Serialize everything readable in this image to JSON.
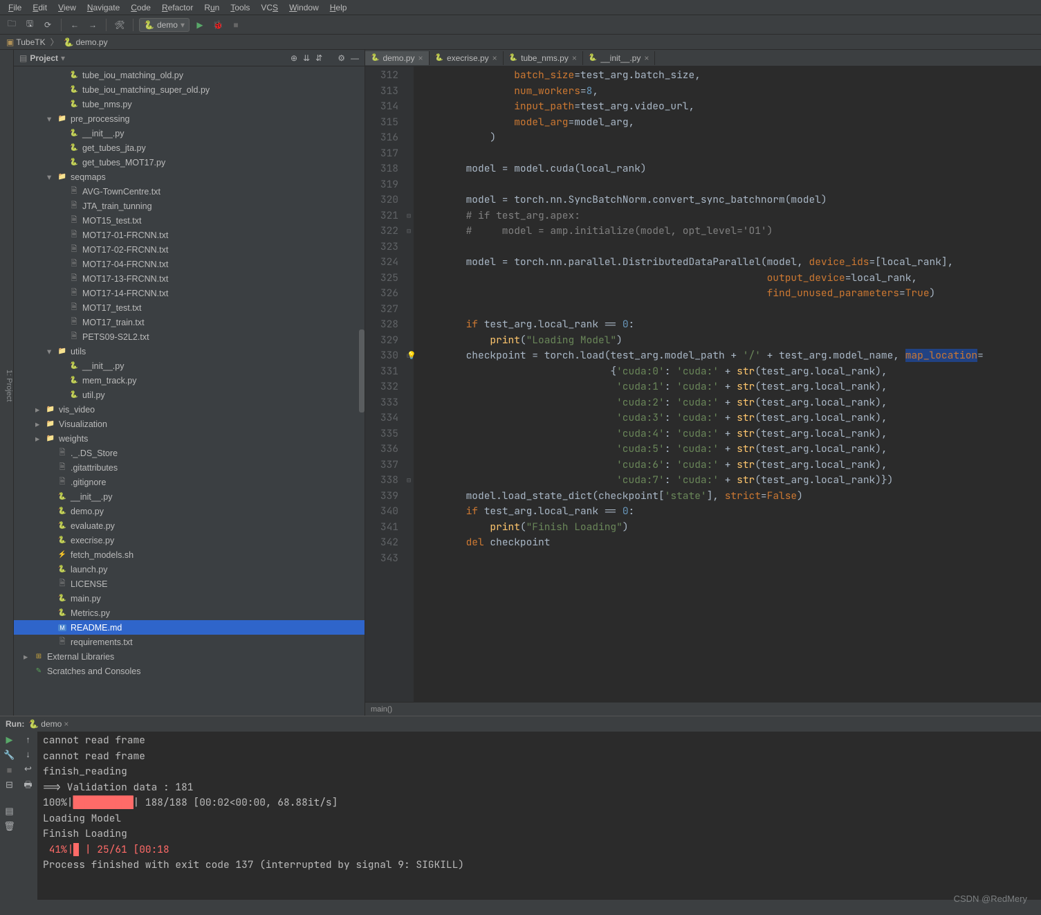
{
  "menu": {
    "file": "File",
    "edit": "Edit",
    "view": "View",
    "navigate": "Navigate",
    "code": "Code",
    "refactor": "Refactor",
    "run": "Run",
    "tools": "Tools",
    "vcs": "VCS",
    "window": "Window",
    "help": "Help"
  },
  "toolbar": {
    "run_config": "demo"
  },
  "breadcrumb": {
    "project": "TubeTK",
    "file": "demo.py"
  },
  "project_panel": {
    "title": "Project",
    "tree": [
      {
        "depth": 3,
        "icon": "py",
        "label": "tube_iou_matching_old.py"
      },
      {
        "depth": 3,
        "icon": "py",
        "label": "tube_iou_matching_super_old.py"
      },
      {
        "depth": 3,
        "icon": "py",
        "label": "tube_nms.py"
      },
      {
        "depth": 2,
        "arrow": "open",
        "icon": "folder",
        "label": "pre_processing"
      },
      {
        "depth": 3,
        "icon": "py",
        "label": "__init__.py"
      },
      {
        "depth": 3,
        "icon": "py",
        "label": "get_tubes_jta.py"
      },
      {
        "depth": 3,
        "icon": "py",
        "label": "get_tubes_MOT17.py"
      },
      {
        "depth": 2,
        "arrow": "open",
        "icon": "folder",
        "label": "seqmaps"
      },
      {
        "depth": 3,
        "icon": "txt",
        "label": "AVG-TownCentre.txt"
      },
      {
        "depth": 3,
        "icon": "txt",
        "label": "JTA_train_tunning"
      },
      {
        "depth": 3,
        "icon": "txt",
        "label": "MOT15_test.txt"
      },
      {
        "depth": 3,
        "icon": "txt",
        "label": "MOT17-01-FRCNN.txt"
      },
      {
        "depth": 3,
        "icon": "txt",
        "label": "MOT17-02-FRCNN.txt"
      },
      {
        "depth": 3,
        "icon": "txt",
        "label": "MOT17-04-FRCNN.txt"
      },
      {
        "depth": 3,
        "icon": "txt",
        "label": "MOT17-13-FRCNN.txt"
      },
      {
        "depth": 3,
        "icon": "txt",
        "label": "MOT17-14-FRCNN.txt"
      },
      {
        "depth": 3,
        "icon": "txt",
        "label": "MOT17_test.txt"
      },
      {
        "depth": 3,
        "icon": "txt",
        "label": "MOT17_train.txt"
      },
      {
        "depth": 3,
        "icon": "txt",
        "label": "PETS09-S2L2.txt"
      },
      {
        "depth": 2,
        "arrow": "open",
        "icon": "folder",
        "label": "utils"
      },
      {
        "depth": 3,
        "icon": "py",
        "label": "__init__.py"
      },
      {
        "depth": 3,
        "icon": "py",
        "label": "mem_track.py"
      },
      {
        "depth": 3,
        "icon": "py",
        "label": "util.py"
      },
      {
        "depth": 1,
        "arrow": "closed",
        "icon": "folder",
        "label": "vis_video"
      },
      {
        "depth": 1,
        "arrow": "closed",
        "icon": "folder",
        "label": "Visualization"
      },
      {
        "depth": 1,
        "arrow": "closed",
        "icon": "folder",
        "label": "weights"
      },
      {
        "depth": 2,
        "icon": "txt",
        "label": "._.DS_Store"
      },
      {
        "depth": 2,
        "icon": "txt",
        "label": ".gitattributes"
      },
      {
        "depth": 2,
        "icon": "txt",
        "label": ".gitignore"
      },
      {
        "depth": 2,
        "icon": "py",
        "label": "__init__.py"
      },
      {
        "depth": 2,
        "icon": "py",
        "label": "demo.py"
      },
      {
        "depth": 2,
        "icon": "py",
        "label": "evaluate.py"
      },
      {
        "depth": 2,
        "icon": "py",
        "label": "execrise.py"
      },
      {
        "depth": 2,
        "icon": "sh",
        "label": "fetch_models.sh"
      },
      {
        "depth": 2,
        "icon": "py",
        "label": "launch.py"
      },
      {
        "depth": 2,
        "icon": "txt",
        "label": "LICENSE"
      },
      {
        "depth": 2,
        "icon": "py",
        "label": "main.py"
      },
      {
        "depth": 2,
        "icon": "py",
        "label": "Metrics.py"
      },
      {
        "depth": 2,
        "icon": "md",
        "label": "README.md",
        "selected": true
      },
      {
        "depth": 2,
        "icon": "txt",
        "label": "requirements.txt"
      },
      {
        "depth": 0,
        "arrow": "closed",
        "icon": "lib",
        "label": "External Libraries"
      },
      {
        "depth": 0,
        "icon": "scr",
        "label": "Scratches and Consoles"
      }
    ]
  },
  "editor": {
    "tabs": [
      {
        "name": "demo.py",
        "active": true
      },
      {
        "name": "execrise.py"
      },
      {
        "name": "tube_nms.py"
      },
      {
        "name": "__init__.py"
      }
    ],
    "crumb": "main()",
    "first_line": 312,
    "code_lines": [
      [
        [
          "p",
          "                "
        ],
        [
          "o",
          "batch_size"
        ],
        [
          "p",
          "=test_arg.batch_size,"
        ]
      ],
      [
        [
          "p",
          "                "
        ],
        [
          "o",
          "num_workers"
        ],
        [
          "p",
          "="
        ],
        [
          "n",
          "8"
        ],
        [
          "p",
          ","
        ]
      ],
      [
        [
          "p",
          "                "
        ],
        [
          "o",
          "input_path"
        ],
        [
          "p",
          "=test_arg.video_url,"
        ]
      ],
      [
        [
          "p",
          "                "
        ],
        [
          "o",
          "model_arg"
        ],
        [
          "p",
          "=model_arg,"
        ]
      ],
      [
        [
          "p",
          "            )"
        ]
      ],
      [],
      [
        [
          "p",
          "        model = model.cuda(local_rank)"
        ]
      ],
      [],
      [
        [
          "p",
          "        model = torch.nn.SyncBatchNorm.convert_sync_batchnorm(model)"
        ]
      ],
      [
        [
          "p",
          "        "
        ],
        [
          "c",
          "# if test_arg.apex:"
        ]
      ],
      [
        [
          "p",
          "        "
        ],
        [
          "c",
          "#     model = amp.initialize(model, opt_level='O1')"
        ]
      ],
      [],
      [
        [
          "p",
          "        model = torch.nn.parallel.DistributedDataParallel(model, "
        ],
        [
          "o",
          "device_ids"
        ],
        [
          "p",
          "=[local_rank],"
        ]
      ],
      [
        [
          "p",
          "                                                          "
        ],
        [
          "o",
          "output_device"
        ],
        [
          "p",
          "=local_rank,"
        ]
      ],
      [
        [
          "p",
          "                                                          "
        ],
        [
          "o",
          "find_unused_parameters"
        ],
        [
          "p",
          "="
        ],
        [
          "k",
          "True"
        ],
        [
          "p",
          ")"
        ]
      ],
      [],
      [
        [
          "p",
          "        "
        ],
        [
          "k",
          "if "
        ],
        [
          "p",
          "test_arg.local_rank == "
        ],
        [
          "n",
          "0"
        ],
        [
          "p",
          ":"
        ]
      ],
      [
        [
          "p",
          "            "
        ],
        [
          "y",
          "print"
        ],
        [
          "p",
          "("
        ],
        [
          "g",
          "\"Loading Model\""
        ],
        [
          "p",
          ")"
        ]
      ],
      [
        [
          "b",
          "        checkpoint = torch.load(test_arg.model_path + "
        ],
        [
          "g",
          "'/'"
        ],
        [
          "p",
          " + test_arg.model_name, "
        ],
        [
          "h",
          "map_location"
        ],
        [
          "p",
          "="
        ]
      ],
      [
        [
          "p",
          "                                {"
        ],
        [
          "g",
          "'cuda:0'"
        ],
        [
          "p",
          ": "
        ],
        [
          "g",
          "'cuda:'"
        ],
        [
          "p",
          " + "
        ],
        [
          "y",
          "str"
        ],
        [
          "p",
          "(test_arg.local_rank),"
        ]
      ],
      [
        [
          "p",
          "                                 "
        ],
        [
          "g",
          "'cuda:1'"
        ],
        [
          "p",
          ": "
        ],
        [
          "g",
          "'cuda:'"
        ],
        [
          "p",
          " + "
        ],
        [
          "y",
          "str"
        ],
        [
          "p",
          "(test_arg.local_rank),"
        ]
      ],
      [
        [
          "p",
          "                                 "
        ],
        [
          "g",
          "'cuda:2'"
        ],
        [
          "p",
          ": "
        ],
        [
          "g",
          "'cuda:'"
        ],
        [
          "p",
          " + "
        ],
        [
          "y",
          "str"
        ],
        [
          "p",
          "(test_arg.local_rank),"
        ]
      ],
      [
        [
          "p",
          "                                 "
        ],
        [
          "g",
          "'cuda:3'"
        ],
        [
          "p",
          ": "
        ],
        [
          "g",
          "'cuda:'"
        ],
        [
          "p",
          " + "
        ],
        [
          "y",
          "str"
        ],
        [
          "p",
          "(test_arg.local_rank),"
        ]
      ],
      [
        [
          "p",
          "                                 "
        ],
        [
          "g",
          "'cuda:4'"
        ],
        [
          "p",
          ": "
        ],
        [
          "g",
          "'cuda:'"
        ],
        [
          "p",
          " + "
        ],
        [
          "y",
          "str"
        ],
        [
          "p",
          "(test_arg.local_rank),"
        ]
      ],
      [
        [
          "p",
          "                                 "
        ],
        [
          "g",
          "'cuda:5'"
        ],
        [
          "p",
          ": "
        ],
        [
          "g",
          "'cuda:'"
        ],
        [
          "p",
          " + "
        ],
        [
          "y",
          "str"
        ],
        [
          "p",
          "(test_arg.local_rank),"
        ]
      ],
      [
        [
          "p",
          "                                 "
        ],
        [
          "g",
          "'cuda:6'"
        ],
        [
          "p",
          ": "
        ],
        [
          "g",
          "'cuda:'"
        ],
        [
          "p",
          " + "
        ],
        [
          "y",
          "str"
        ],
        [
          "p",
          "(test_arg.local_rank),"
        ]
      ],
      [
        [
          "p",
          "                                 "
        ],
        [
          "g",
          "'cuda:7'"
        ],
        [
          "p",
          ": "
        ],
        [
          "g",
          "'cuda:'"
        ],
        [
          "p",
          " + "
        ],
        [
          "y",
          "str"
        ],
        [
          "p",
          "(test_arg.local_rank)})"
        ]
      ],
      [
        [
          "p",
          "        model.load_state_dict(checkpoint["
        ],
        [
          "g",
          "'state'"
        ],
        [
          "p",
          "], "
        ],
        [
          "o",
          "strict"
        ],
        [
          "p",
          "="
        ],
        [
          "k",
          "False"
        ],
        [
          "p",
          ")"
        ]
      ],
      [
        [
          "p",
          "        "
        ],
        [
          "k",
          "if "
        ],
        [
          "p",
          "test_arg.local_rank == "
        ],
        [
          "n",
          "0"
        ],
        [
          "p",
          ":"
        ]
      ],
      [
        [
          "p",
          "            "
        ],
        [
          "y",
          "print"
        ],
        [
          "p",
          "("
        ],
        [
          "g",
          "\"Finish Loading\""
        ],
        [
          "p",
          ")"
        ]
      ],
      [
        [
          "p",
          "        "
        ],
        [
          "k",
          "del "
        ],
        [
          "p",
          "checkpoint"
        ]
      ],
      []
    ]
  },
  "run": {
    "title": "Run:",
    "config": "demo",
    "output": [
      {
        "t": "cannot read frame",
        "cls": ""
      },
      {
        "t": "cannot read frame",
        "cls": ""
      },
      {
        "t": "finish_reading",
        "cls": ""
      },
      {
        "t": "==> Validation data : 181",
        "cls": ""
      },
      {
        "parts": [
          [
            "p",
            "100%|"
          ],
          [
            "rb",
            "██████████"
          ],
          [
            "p",
            "| 188/188 [00:02<00:00, 68.88it/s]"
          ]
        ]
      },
      {
        "t": "Loading Model",
        "cls": ""
      },
      {
        "t": "Finish Loading",
        "cls": ""
      },
      {
        "parts": [
          [
            "r",
            " 41%|"
          ],
          [
            "rb",
            "|"
          ],
          [
            "r",
            " | 25/61 [00:18"
          ]
        ]
      },
      {
        "t": "Process finished with exit code 137 (interrupted by signal 9: SIGKILL)",
        "cls": ""
      }
    ]
  },
  "watermark": "CSDN @RedMery"
}
